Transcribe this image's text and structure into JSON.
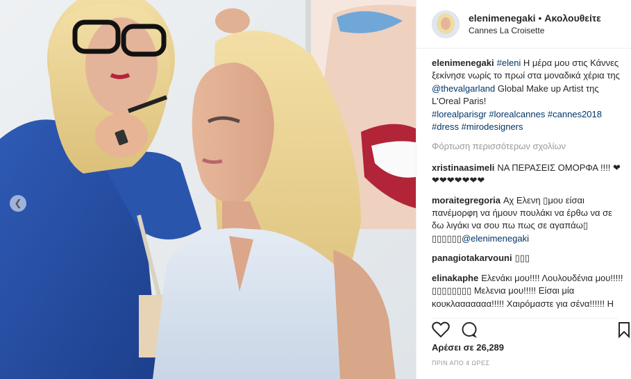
{
  "post": {
    "username": "elenimenegaki",
    "separator": "•",
    "follow_label": "Ακολουθείτε",
    "location": "Cannes La Croisette"
  },
  "caption": {
    "username": "elenimenegaki",
    "tag1": "#eleni",
    "text1": " Η μέρα μου στις Κάννες ξεκίνησε νωρίς το πρωί στα μοναδικά χέρια της ",
    "mention": "@thevalgarland",
    "text2": " Global Make up Artist της L'Oreal Paris!",
    "hashtags": "#lorealparisgr #lorealcannes #cannes2018 #dress #mirodesigners"
  },
  "load_more": "Φόρτωση περισσότερων σχολίων",
  "comments": [
    {
      "user": "xristinaasimeli",
      "text": "ΝΑ ΠΕΡΑΣΕΙΣ ΟΜΟΡΦΑ !!!! ❤❤❤❤❤❤❤❤"
    },
    {
      "user": "moraitegregoria",
      "text": "Αχ Ελενη ▯μου είσαι πανέμορφη να ήμουν πουλάκι να έρθω να σε δω λιγάκι να σου πω πως σε αγαπάω▯ ▯▯▯▯▯▯",
      "mention": "@elenimenegaki"
    },
    {
      "user": "panagiotakarvouni",
      "text": "▯▯▯"
    },
    {
      "user": "elinakaphe",
      "text": "Ελενάκι μου!!!! Λουλουδένια μου!!!!!▯▯▯▯▯▯▯▯ Μελενια μου!!!!! Είσαι μία κουκλααααααα!!!!! Χαιρόμαστε για σένα!!!!!! Η χαρά σου είναι κ δικιά μας!!!!!! Να περάσεις υπέροχα!!!!!! Φιλιααααααα"
    }
  ],
  "likes": "Αρέσει σε 26,289",
  "timestamp": "ΠΡΙΝ ΑΠΟ 4 ΩΡΕΣ",
  "colors": {
    "link": "#003569",
    "muted": "#999999",
    "text": "#262626"
  }
}
